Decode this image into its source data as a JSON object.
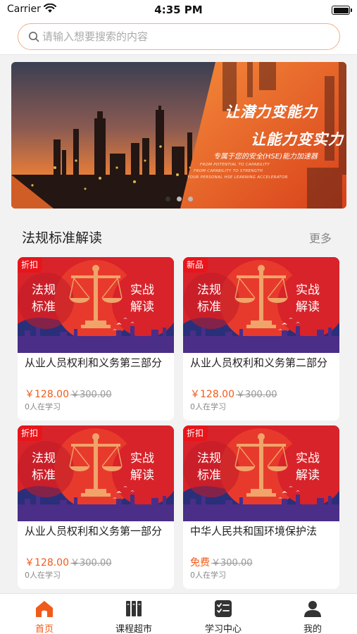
{
  "status_bar": {
    "carrier": "Carrier",
    "time": "4:35 PM"
  },
  "search": {
    "placeholder": "请输入想要搜索的内容",
    "value": ""
  },
  "banner": {
    "title_line1": "让潜力变能力",
    "title_line2": "让能力变实力",
    "subtitle": "专属于您的安全(HSE)能力加速器",
    "english_lines": [
      "FROM POTENTIAL TO CAPABILITY",
      "FROM CAPABILITY TO STRENGTH",
      "YOUR PERSONAL HSE LEARNING ACCELERATOR"
    ],
    "page_count": 3,
    "active_page": 1
  },
  "section": {
    "title": "法规标准解读",
    "more": "更多"
  },
  "card_image_text": {
    "left": "法规\n标准",
    "right": "实战\n解读"
  },
  "courses": [
    {
      "badge": "折扣",
      "title": "从业人员权利和义务第三部分",
      "price": "￥128.00",
      "original_price": "￥300.00",
      "learners": "0人在学习"
    },
    {
      "badge": "新品",
      "title": "从业人员权利和义务第二部分",
      "price": "￥128.00",
      "original_price": "￥300.00",
      "learners": "0人在学习"
    },
    {
      "badge": "折扣",
      "title": "从业人员权利和义务第一部分",
      "price": "￥128.00",
      "original_price": "￥300.00",
      "learners": "0人在学习"
    },
    {
      "badge": "折扣",
      "title": "中华人民共和国环境保护法",
      "price": "免费",
      "original_price": "￥300.00",
      "learners": "0人在学习"
    }
  ],
  "tabs": [
    {
      "label": "首页",
      "icon": "home-icon",
      "active": true
    },
    {
      "label": "课程超市",
      "icon": "books-icon",
      "active": false
    },
    {
      "label": "学习中心",
      "icon": "checklist-icon",
      "active": false
    },
    {
      "label": "我的",
      "icon": "user-icon",
      "active": false
    }
  ],
  "colors": {
    "accent": "#f05a1a",
    "badge": "#e8151b",
    "card_red": "#d8232a",
    "card_navy": "#2a2f7a",
    "scale_gold": "#f0a46a"
  }
}
